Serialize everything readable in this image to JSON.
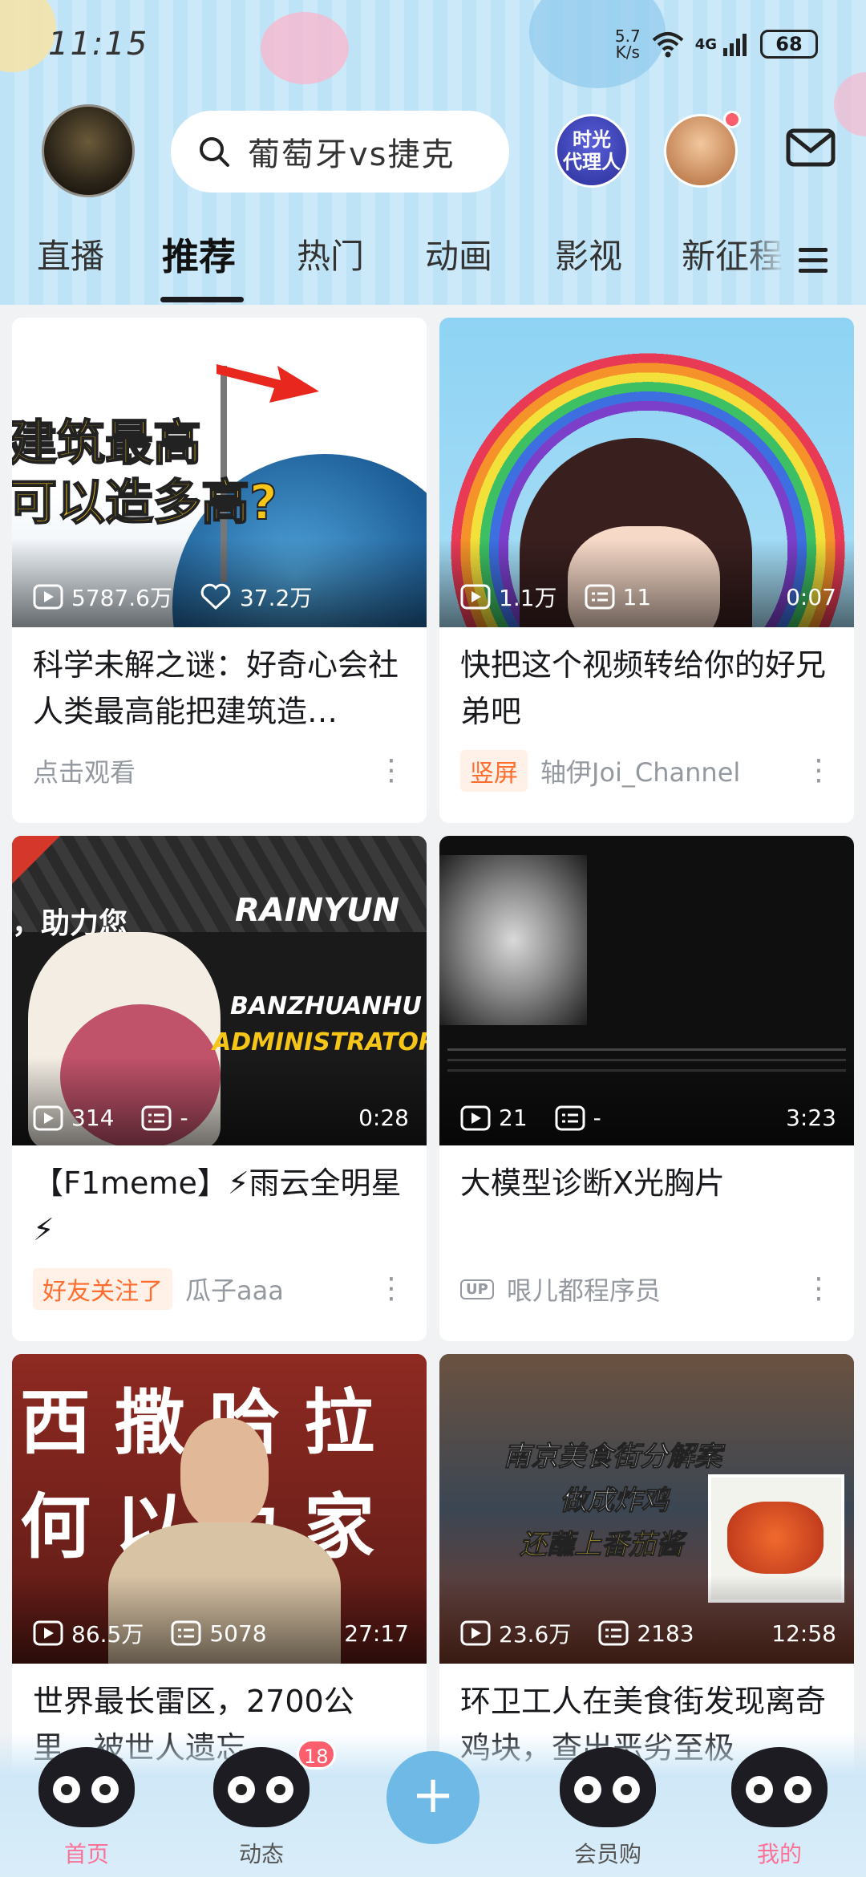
{
  "status_bar": {
    "time": "11:15",
    "net_speed_value": "5.7",
    "net_speed_unit": "K/s",
    "network": "4G",
    "battery": "68"
  },
  "header": {
    "search_placeholder": "葡萄牙vs捷克",
    "guide_badge_line1": "时光",
    "guide_badge_line2": "代理人"
  },
  "tabs": [
    "直播",
    "推荐",
    "热门",
    "动画",
    "影视",
    "新征程"
  ],
  "active_tab": "推荐",
  "feed": [
    {
      "thumb_text_line1": "建筑最高",
      "thumb_text_line2": "可以造多高?",
      "stat1": "5787.6万",
      "stat1_icon": "play-icon",
      "stat2": "37.2万",
      "stat2_icon": "heart-icon",
      "duration": "",
      "title": "科学未解之谜：好奇心会社 人类最高能把建筑造…",
      "footer_tag": "",
      "footer_text": "点击观看"
    },
    {
      "stat1": "1.1万",
      "stat1_icon": "play-icon",
      "stat2": "11",
      "stat2_icon": "danmaku-icon",
      "duration": "0:07",
      "title": "快把这个视频转给你的好兄弟吧",
      "footer_tag": "竖屏",
      "footer_text": "轴伊Joi_Channel"
    },
    {
      "thumb_text_line1": "RAINYUN",
      "thumb_text_line2": "BANZHUANHU",
      "thumb_text_line3": "ADMINISTRATOR",
      "thumb_text_line4": "，助力您",
      "stat1": "314",
      "stat1_icon": "play-icon",
      "stat2": "-",
      "stat2_icon": "danmaku-icon",
      "duration": "0:28",
      "title": "【F1meme】⚡雨云全明星⚡",
      "footer_tag": "好友关注了",
      "footer_text": "瓜子aaa"
    },
    {
      "stat1": "21",
      "stat1_icon": "play-icon",
      "stat2": "-",
      "stat2_icon": "danmaku-icon",
      "duration": "3:23",
      "title": "大模型诊断X光胸片",
      "footer_tag": "UP",
      "footer_text": "哏儿都程序员"
    },
    {
      "thumb_text_line1": "西撒哈拉",
      "thumb_text_line2": "何以为家",
      "stat1": "86.5万",
      "stat1_icon": "play-icon",
      "stat2": "5078",
      "stat2_icon": "danmaku-icon",
      "duration": "27:17",
      "title": "世界最长雷区，2700公里…被世人遗忘…",
      "footer_tag": "",
      "footer_text": ""
    },
    {
      "thumb_text_line1": "南京美食街分解案",
      "thumb_text_line2": "做成炸鸡",
      "thumb_text_line3": "还蘸上番茄酱",
      "stat1": "23.6万",
      "stat1_icon": "play-icon",
      "stat2": "2183",
      "stat2_icon": "danmaku-icon",
      "duration": "12:58",
      "title": "环卫工人在美食街发现离奇鸡块，查出恶劣至极",
      "footer_tag": "",
      "footer_text": ""
    }
  ],
  "bottom_nav": {
    "home": "首页",
    "dynamic": "动态",
    "dynamic_badge": "18",
    "plus": "+",
    "vip": "会员购",
    "mine": "我的"
  },
  "colors": {
    "accent": "#fb7299",
    "header_bg": "#c6e6f8",
    "tag_orange": "#ff6e2e"
  }
}
